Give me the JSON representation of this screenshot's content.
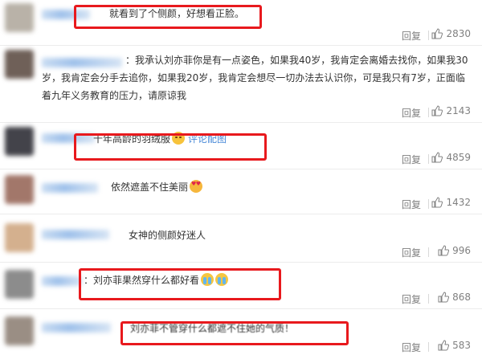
{
  "comments": [
    {
      "text": "就看到了个侧颜，好想看正脸。",
      "reply": "回复",
      "likes": "2830"
    },
    {
      "text": "：我承认刘亦菲你是有一点姿色，如果我40岁，我肯定会离婚去找你，如果我30岁，我肯定会分手去追你，如果我20岁，我肯定会想尽一切办法去认识你，可是我只有7岁，正面临着九年义务教育的压力，请原谅我",
      "reply": "回复",
      "likes": "2143"
    },
    {
      "text": "十年高龄的羽绒服",
      "emoji": "blush-face-icon",
      "link": "评论配图",
      "reply": "回复",
      "likes": "4859"
    },
    {
      "text": "依然遮盖不住美丽",
      "emoji": "heart-eyes-icon",
      "reply": "回复",
      "likes": "1432"
    },
    {
      "text": "女神的侧颜好迷人",
      "reply": "回复",
      "likes": "996"
    },
    {
      "text": "：刘亦菲果然穿什么都好看",
      "emoji": "crying-face-icon",
      "reply": "回复",
      "likes": "868"
    },
    {
      "text": "刘亦菲不管穿什么都遮不住她的气质！",
      "reply": "回复",
      "likes": "583"
    }
  ],
  "colors": {
    "highlight": "#e8191d",
    "link": "#4a8ad8",
    "meta": "#808080"
  }
}
